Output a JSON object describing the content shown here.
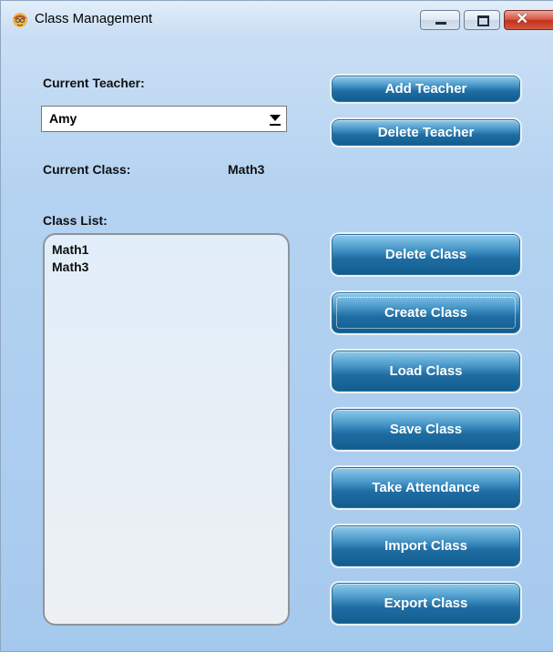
{
  "window": {
    "title": "Class Management",
    "icon": "teacher-app-icon",
    "controls": {
      "minimize": "minimize-icon",
      "maximize": "maximize-icon",
      "close": "close-icon"
    }
  },
  "teacher": {
    "label": "Current Teacher:",
    "selected": "Amy"
  },
  "current_class": {
    "label": "Current Class:",
    "value": "Math3"
  },
  "class_list": {
    "label": "Class List:",
    "items": [
      "Math1",
      "Math3"
    ]
  },
  "buttons": {
    "add_teacher": "Add Teacher",
    "delete_teacher": "Delete Teacher",
    "delete_class": "Delete Class",
    "create_class": "Create Class",
    "load_class": "Load Class",
    "save_class": "Save Class",
    "take_attendance": "Take Attendance",
    "import_class": "Import Class",
    "export_class": "Export Class"
  },
  "colors": {
    "button_top": "#8fcaec",
    "button_bottom": "#125d8f",
    "window_bg": "#b5d3f1",
    "close_red": "#c1311c"
  }
}
